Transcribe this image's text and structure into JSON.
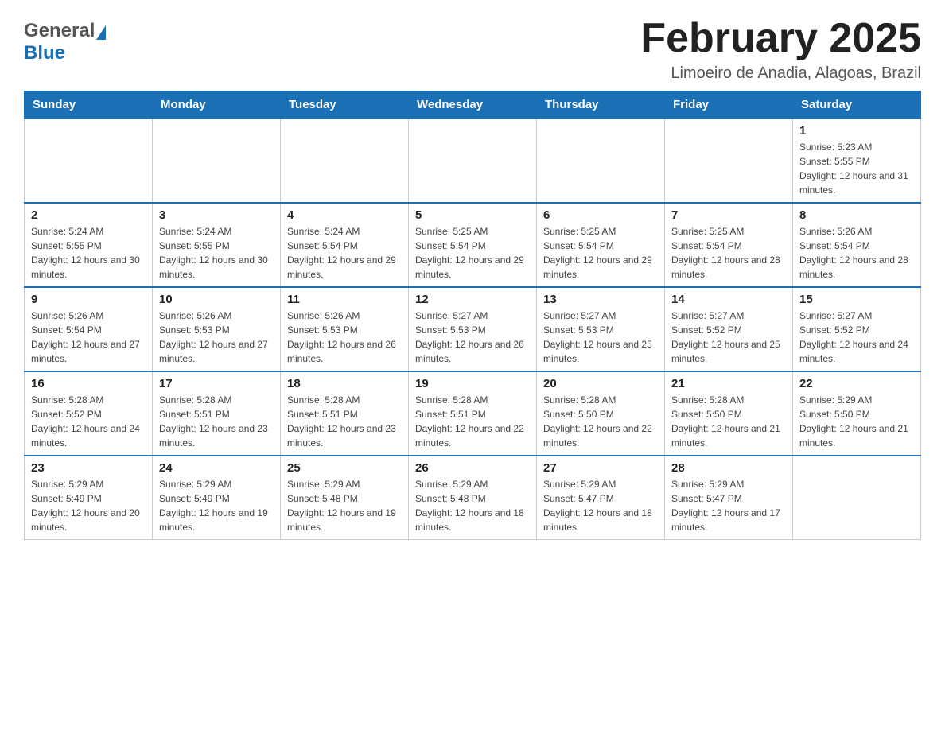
{
  "header": {
    "logo_general": "General",
    "logo_blue": "Blue",
    "month_title": "February 2025",
    "location": "Limoeiro de Anadia, Alagoas, Brazil"
  },
  "days_of_week": [
    "Sunday",
    "Monday",
    "Tuesday",
    "Wednesday",
    "Thursday",
    "Friday",
    "Saturday"
  ],
  "weeks": [
    [
      {
        "day": "",
        "info": ""
      },
      {
        "day": "",
        "info": ""
      },
      {
        "day": "",
        "info": ""
      },
      {
        "day": "",
        "info": ""
      },
      {
        "day": "",
        "info": ""
      },
      {
        "day": "",
        "info": ""
      },
      {
        "day": "1",
        "info": "Sunrise: 5:23 AM\nSunset: 5:55 PM\nDaylight: 12 hours and 31 minutes."
      }
    ],
    [
      {
        "day": "2",
        "info": "Sunrise: 5:24 AM\nSunset: 5:55 PM\nDaylight: 12 hours and 30 minutes."
      },
      {
        "day": "3",
        "info": "Sunrise: 5:24 AM\nSunset: 5:55 PM\nDaylight: 12 hours and 30 minutes."
      },
      {
        "day": "4",
        "info": "Sunrise: 5:24 AM\nSunset: 5:54 PM\nDaylight: 12 hours and 29 minutes."
      },
      {
        "day": "5",
        "info": "Sunrise: 5:25 AM\nSunset: 5:54 PM\nDaylight: 12 hours and 29 minutes."
      },
      {
        "day": "6",
        "info": "Sunrise: 5:25 AM\nSunset: 5:54 PM\nDaylight: 12 hours and 29 minutes."
      },
      {
        "day": "7",
        "info": "Sunrise: 5:25 AM\nSunset: 5:54 PM\nDaylight: 12 hours and 28 minutes."
      },
      {
        "day": "8",
        "info": "Sunrise: 5:26 AM\nSunset: 5:54 PM\nDaylight: 12 hours and 28 minutes."
      }
    ],
    [
      {
        "day": "9",
        "info": "Sunrise: 5:26 AM\nSunset: 5:54 PM\nDaylight: 12 hours and 27 minutes."
      },
      {
        "day": "10",
        "info": "Sunrise: 5:26 AM\nSunset: 5:53 PM\nDaylight: 12 hours and 27 minutes."
      },
      {
        "day": "11",
        "info": "Sunrise: 5:26 AM\nSunset: 5:53 PM\nDaylight: 12 hours and 26 minutes."
      },
      {
        "day": "12",
        "info": "Sunrise: 5:27 AM\nSunset: 5:53 PM\nDaylight: 12 hours and 26 minutes."
      },
      {
        "day": "13",
        "info": "Sunrise: 5:27 AM\nSunset: 5:53 PM\nDaylight: 12 hours and 25 minutes."
      },
      {
        "day": "14",
        "info": "Sunrise: 5:27 AM\nSunset: 5:52 PM\nDaylight: 12 hours and 25 minutes."
      },
      {
        "day": "15",
        "info": "Sunrise: 5:27 AM\nSunset: 5:52 PM\nDaylight: 12 hours and 24 minutes."
      }
    ],
    [
      {
        "day": "16",
        "info": "Sunrise: 5:28 AM\nSunset: 5:52 PM\nDaylight: 12 hours and 24 minutes."
      },
      {
        "day": "17",
        "info": "Sunrise: 5:28 AM\nSunset: 5:51 PM\nDaylight: 12 hours and 23 minutes."
      },
      {
        "day": "18",
        "info": "Sunrise: 5:28 AM\nSunset: 5:51 PM\nDaylight: 12 hours and 23 minutes."
      },
      {
        "day": "19",
        "info": "Sunrise: 5:28 AM\nSunset: 5:51 PM\nDaylight: 12 hours and 22 minutes."
      },
      {
        "day": "20",
        "info": "Sunrise: 5:28 AM\nSunset: 5:50 PM\nDaylight: 12 hours and 22 minutes."
      },
      {
        "day": "21",
        "info": "Sunrise: 5:28 AM\nSunset: 5:50 PM\nDaylight: 12 hours and 21 minutes."
      },
      {
        "day": "22",
        "info": "Sunrise: 5:29 AM\nSunset: 5:50 PM\nDaylight: 12 hours and 21 minutes."
      }
    ],
    [
      {
        "day": "23",
        "info": "Sunrise: 5:29 AM\nSunset: 5:49 PM\nDaylight: 12 hours and 20 minutes."
      },
      {
        "day": "24",
        "info": "Sunrise: 5:29 AM\nSunset: 5:49 PM\nDaylight: 12 hours and 19 minutes."
      },
      {
        "day": "25",
        "info": "Sunrise: 5:29 AM\nSunset: 5:48 PM\nDaylight: 12 hours and 19 minutes."
      },
      {
        "day": "26",
        "info": "Sunrise: 5:29 AM\nSunset: 5:48 PM\nDaylight: 12 hours and 18 minutes."
      },
      {
        "day": "27",
        "info": "Sunrise: 5:29 AM\nSunset: 5:47 PM\nDaylight: 12 hours and 18 minutes."
      },
      {
        "day": "28",
        "info": "Sunrise: 5:29 AM\nSunset: 5:47 PM\nDaylight: 12 hours and 17 minutes."
      },
      {
        "day": "",
        "info": ""
      }
    ]
  ]
}
